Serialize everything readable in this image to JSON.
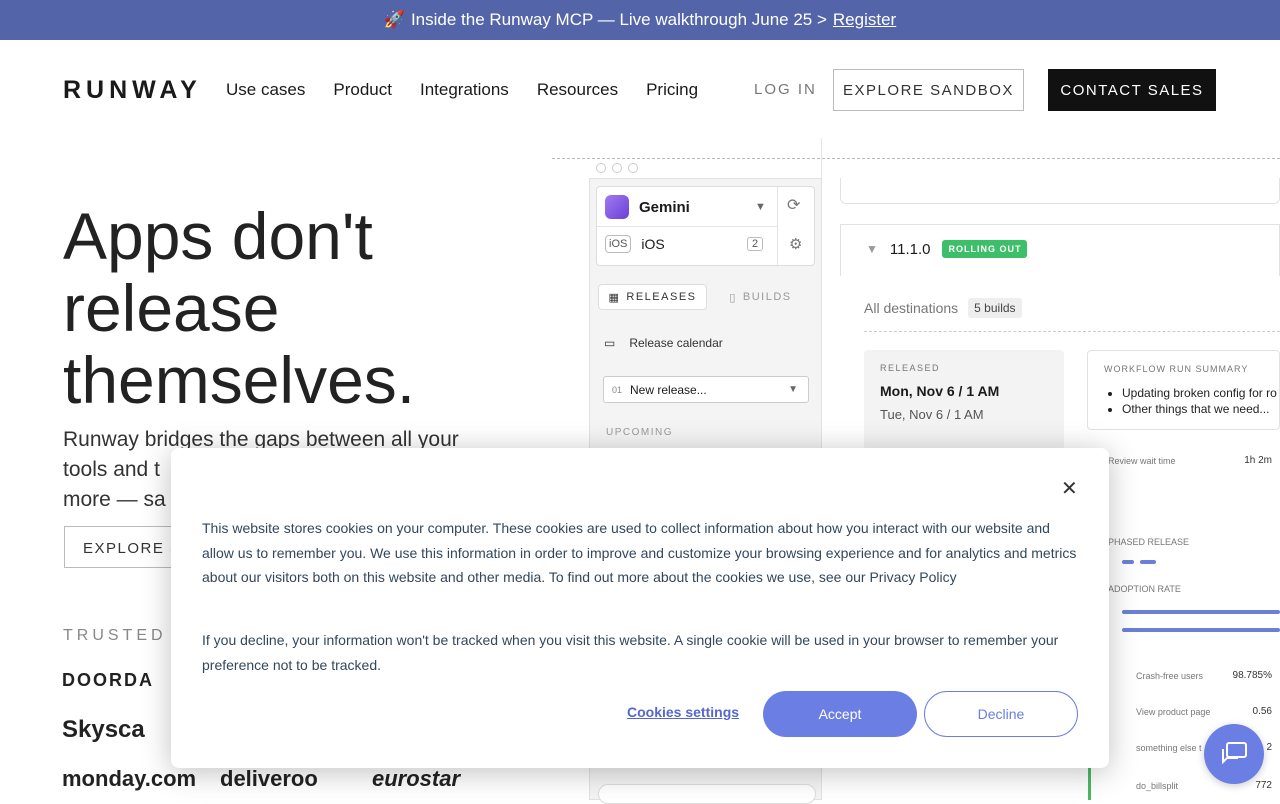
{
  "banner": {
    "icon": "rocket-icon",
    "text": "Inside the Runway MCP — Live walkthrough June 25 >",
    "link": "Register"
  },
  "nav": {
    "logo": "RUNWAY",
    "links": [
      "Use cases",
      "Product",
      "Integrations",
      "Resources",
      "Pricing"
    ],
    "login": "LOG IN",
    "sandbox": "EXPLORE SANDBOX",
    "contact": "CONTACT SALES"
  },
  "hero": {
    "title_lines": [
      "Apps don't",
      "release",
      "themselves."
    ],
    "subtitle": "Runway bridges the gaps between all your tools and t… more — sa…",
    "sub_lines": [
      "Runway bridges the gaps between all your",
      "tools and t",
      "more — sa"
    ],
    "explore": "EXPLORE S",
    "trusted": "TRUSTED B",
    "logos": [
      "DOORDA",
      "Skysca",
      "monday.com",
      "deliveroo",
      "eurostar"
    ]
  },
  "mockup": {
    "app_name": "Gemini",
    "platform": "iOS",
    "platform_badge": "iOS",
    "platform_count": "2",
    "tab_releases": "RELEASES",
    "tab_builds": "BUILDS",
    "calendar": "Release calendar",
    "new_release_prefix": "01",
    "new_release": "New release...",
    "upcoming": "UPCOMING",
    "version": "11.1.0",
    "status": "ROLLING OUT",
    "destinations": "All destinations",
    "builds_count": "5 builds",
    "released_label": "RELEASED",
    "released_date1": "Mon, Nov 6  /  1 AM",
    "released_date2": "Tue, Nov 6  /  1 AM",
    "workflow_label": "WORKFLOW RUN SUMMARY",
    "workflow_items": [
      "Updating broken config for ro",
      "Other things that we need..."
    ],
    "review_wait": "Review wait time",
    "review_value": "1h 2m",
    "phased": "PHASED RELEASE",
    "adoption": "ADOPTION RATE",
    "metric1": "Crash-free users",
    "metric1_value": "98.785%",
    "metric2": "View product page",
    "metric2_value": "0.56",
    "metric3": "something else t",
    "metric3_value": "2",
    "metric4": "do_billsplit",
    "metric4_value": "772"
  },
  "cookie": {
    "paragraph1": "This website stores cookies on your computer. These cookies are used to collect information about how you interact with our website and allow us to remember you. We use this information in order to improve and customize your browsing experience and for analytics and metrics about our visitors both on this website and other media. To find out more about the cookies we use, see our Privacy Policy",
    "paragraph2": "If you decline, your information won't be tracked when you visit this website. A single cookie will be used in your browser to remember your preference not to be tracked.",
    "settings": "Cookies settings",
    "accept": "Accept",
    "decline": "Decline"
  },
  "colors": {
    "banner": "#5464a8",
    "accent": "#6b7ee3",
    "rolling": "#3dbf6a"
  }
}
